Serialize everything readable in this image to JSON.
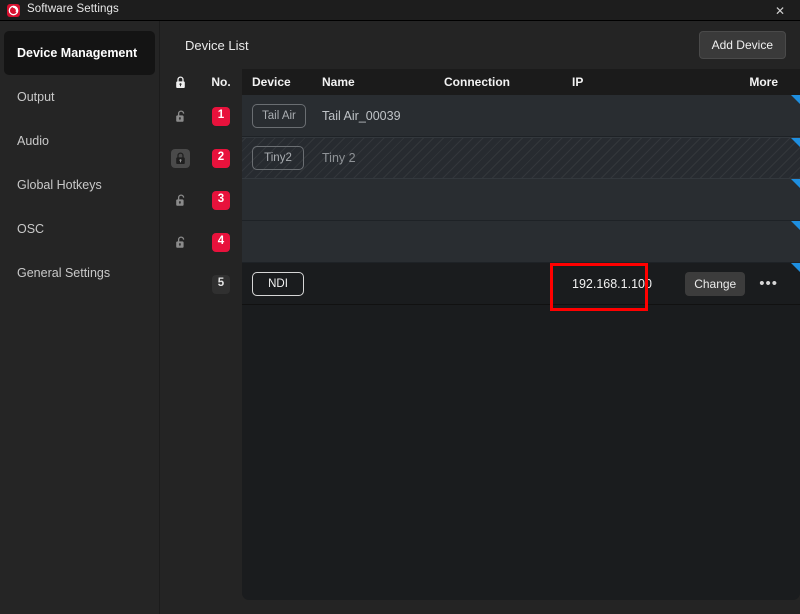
{
  "window": {
    "title": "Software Settings",
    "app_icon": "camera-shutter-icon",
    "close_label": "✕"
  },
  "sidebar": {
    "items": [
      {
        "label": "Device Management",
        "active": true
      },
      {
        "label": "Output",
        "active": false
      },
      {
        "label": "Audio",
        "active": false
      },
      {
        "label": "Global Hotkeys",
        "active": false
      },
      {
        "label": "OSC",
        "active": false
      },
      {
        "label": "General Settings",
        "active": false
      }
    ]
  },
  "main": {
    "panel_title": "Device List",
    "add_device_label": "Add Device"
  },
  "table": {
    "headers": {
      "lock": "lock-icon",
      "no": "No.",
      "device": "Device",
      "name": "Name",
      "connection": "Connection",
      "ip": "IP",
      "more": "More"
    },
    "rows": [
      {
        "no": "1",
        "lock": "unlocked",
        "device": "Tail Air",
        "name": "Tail Air_00039",
        "connection": "",
        "ip": "",
        "change_label": "",
        "more": "",
        "style": "normal"
      },
      {
        "no": "2",
        "lock": "locked",
        "device": "Tiny2",
        "name": "Tiny 2",
        "connection": "",
        "ip": "",
        "change_label": "",
        "more": "",
        "style": "hatched"
      },
      {
        "no": "3",
        "lock": "unlocked",
        "device": "",
        "name": "",
        "connection": "",
        "ip": "",
        "change_label": "",
        "more": "",
        "style": "normal"
      },
      {
        "no": "4",
        "lock": "unlocked",
        "device": "",
        "name": "",
        "connection": "",
        "ip": "",
        "change_label": "",
        "more": "",
        "style": "normal"
      },
      {
        "no": "5",
        "lock": "none",
        "device": "NDI",
        "name": "",
        "connection": "",
        "ip": "192.168.1.100",
        "change_label": "Change",
        "more": "•••",
        "style": "dark"
      }
    ]
  },
  "annotation": {
    "highlight_color": "#ff0000",
    "target": "ip-cell-row-5"
  },
  "colors": {
    "accent_red": "#e8123c",
    "corner_blue": "#1e8fe0",
    "titlebar": "#1d1d1d",
    "sidebar": "#252525",
    "row": "#292d31",
    "row_dark": "#1a1c1e"
  }
}
